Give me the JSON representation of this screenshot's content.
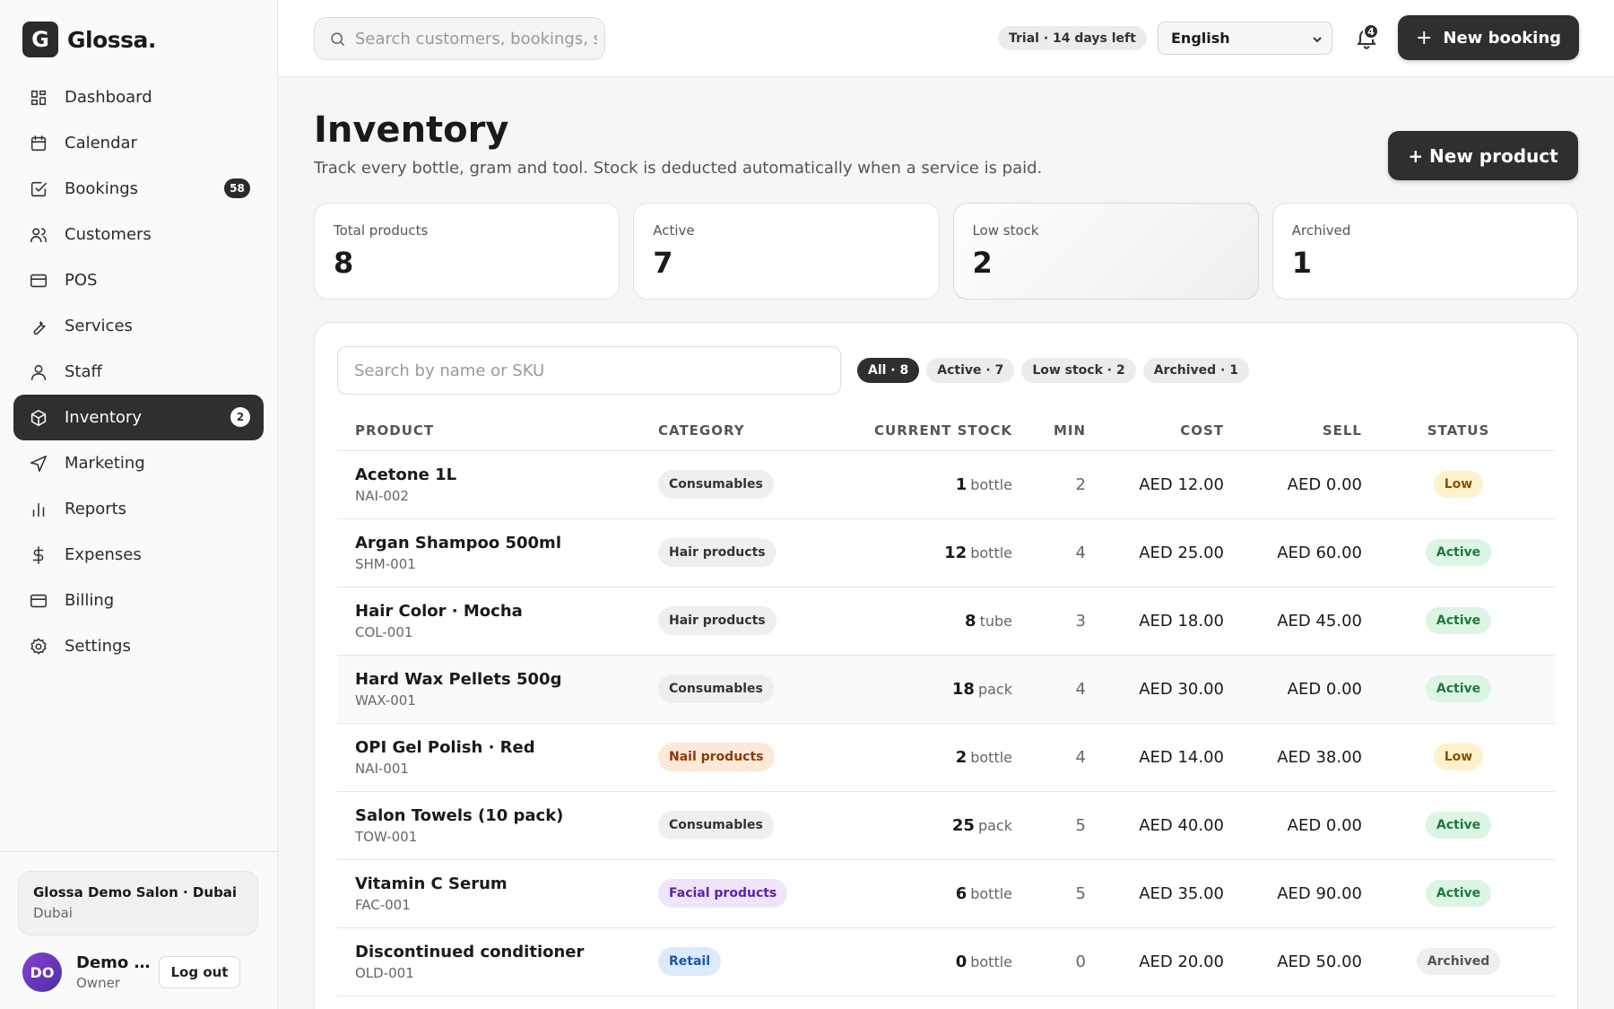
{
  "brand": {
    "mark": "G",
    "name": "Glossa."
  },
  "sidebar": {
    "items": [
      {
        "label": "Dashboard",
        "icon": "grid-icon"
      },
      {
        "label": "Calendar",
        "icon": "calendar-icon"
      },
      {
        "label": "Bookings",
        "icon": "check-square-icon",
        "badge": "58"
      },
      {
        "label": "Customers",
        "icon": "users-icon"
      },
      {
        "label": "POS",
        "icon": "card-icon"
      },
      {
        "label": "Services",
        "icon": "wrench-icon"
      },
      {
        "label": "Staff",
        "icon": "user-icon"
      },
      {
        "label": "Inventory",
        "icon": "box-icon",
        "badge": "2",
        "active": true
      },
      {
        "label": "Marketing",
        "icon": "send-icon"
      },
      {
        "label": "Reports",
        "icon": "bar-chart-icon"
      },
      {
        "label": "Expenses",
        "icon": "dollar-icon"
      },
      {
        "label": "Billing",
        "icon": "card-icon"
      },
      {
        "label": "Settings",
        "icon": "gear-icon"
      }
    ],
    "salon": {
      "name": "Glossa Demo Salon · Dubai",
      "city": "Dubai"
    },
    "user": {
      "initials": "DO",
      "name": "Demo Owner",
      "role": "Owner",
      "logout_label": "Log out"
    }
  },
  "topbar": {
    "search_placeholder": "Search customers, bookings, services",
    "trial": "Trial · 14 days left",
    "language": "English",
    "notifications": "4",
    "new_booking_label": "New booking"
  },
  "page": {
    "title": "Inventory",
    "subtitle": "Track every bottle, gram and tool. Stock is deducted automatically when a service is paid.",
    "new_product_label": "+ New product"
  },
  "stats": [
    {
      "label": "Total products",
      "value": "8"
    },
    {
      "label": "Active",
      "value": "7"
    },
    {
      "label": "Low stock",
      "value": "2"
    },
    {
      "label": "Archived",
      "value": "1"
    }
  ],
  "table": {
    "search_placeholder": "Search by name or SKU",
    "filters": [
      "All · 8",
      "Active · 7",
      "Low stock · 2",
      "Archived · 1"
    ],
    "columns": [
      "PRODUCT",
      "CATEGORY",
      "CURRENT STOCK",
      "MIN",
      "COST",
      "SELL",
      "STATUS"
    ],
    "rows": [
      {
        "name": "Acetone 1L",
        "sku": "NAI-002",
        "category": "Consumables",
        "cat_style": "",
        "stock": "1",
        "unit": "bottle",
        "min": "2",
        "cost": "AED 12.00",
        "sell": "AED 0.00",
        "status": "Low",
        "status_style": "low"
      },
      {
        "name": "Argan Shampoo 500ml",
        "sku": "SHM-001",
        "category": "Hair products",
        "cat_style": "",
        "stock": "12",
        "unit": "bottle",
        "min": "4",
        "cost": "AED 25.00",
        "sell": "AED 60.00",
        "status": "Active",
        "status_style": "active"
      },
      {
        "name": "Hair Color · Mocha",
        "sku": "COL-001",
        "category": "Hair products",
        "cat_style": "",
        "stock": "8",
        "unit": "tube",
        "min": "3",
        "cost": "AED 18.00",
        "sell": "AED 45.00",
        "status": "Active",
        "status_style": "active"
      },
      {
        "name": "Hard Wax Pellets 500g",
        "sku": "WAX-001",
        "category": "Consumables",
        "cat_style": "",
        "stock": "18",
        "unit": "pack",
        "min": "4",
        "cost": "AED 30.00",
        "sell": "AED 0.00",
        "status": "Active",
        "status_style": "active"
      },
      {
        "name": "OPI Gel Polish · Red",
        "sku": "NAI-001",
        "category": "Nail products",
        "cat_style": "nail",
        "stock": "2",
        "unit": "bottle",
        "min": "4",
        "cost": "AED 14.00",
        "sell": "AED 38.00",
        "status": "Low",
        "status_style": "low"
      },
      {
        "name": "Salon Towels (10 pack)",
        "sku": "TOW-001",
        "category": "Consumables",
        "cat_style": "",
        "stock": "25",
        "unit": "pack",
        "min": "5",
        "cost": "AED 40.00",
        "sell": "AED 0.00",
        "status": "Active",
        "status_style": "active"
      },
      {
        "name": "Vitamin C Serum",
        "sku": "FAC-001",
        "category": "Facial products",
        "cat_style": "facial",
        "stock": "6",
        "unit": "bottle",
        "min": "5",
        "cost": "AED 35.00",
        "sell": "AED 90.00",
        "status": "Active",
        "status_style": "active"
      },
      {
        "name": "Discontinued conditioner",
        "sku": "OLD-001",
        "category": "Retail",
        "cat_style": "retail",
        "stock": "0",
        "unit": "bottle",
        "min": "0",
        "cost": "AED 20.00",
        "sell": "AED 50.00",
        "status": "Archived",
        "status_style": "archived"
      }
    ]
  },
  "colors": {
    "dark": "#2f2f2f",
    "low": "#fdf2cc",
    "active": "#dcf5e4",
    "nail": "#fde9d7",
    "facial": "#efe5fb",
    "retail": "#dcebfb"
  }
}
